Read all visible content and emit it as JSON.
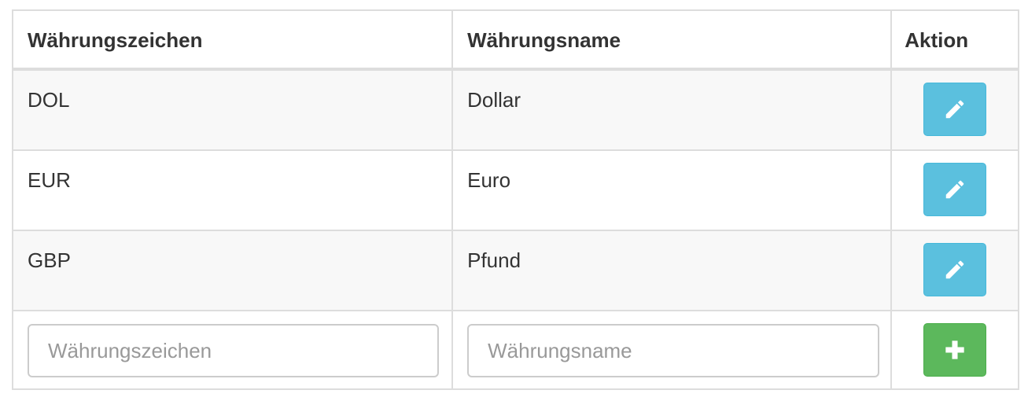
{
  "table": {
    "headers": {
      "code": "Währungszeichen",
      "name": "Währungsname",
      "action": "Aktion"
    },
    "rows": [
      {
        "code": "DOL",
        "name": "Dollar"
      },
      {
        "code": "EUR",
        "name": "Euro"
      },
      {
        "code": "GBP",
        "name": "Pfund"
      }
    ],
    "new_row": {
      "code_placeholder": "Währungszeichen",
      "name_placeholder": "Währungsname"
    }
  },
  "icons": {
    "edit": "pencil-icon",
    "add": "plus-icon"
  },
  "colors": {
    "edit_button": "#5bc0de",
    "add_button": "#5cb85c",
    "stripe": "#f8f8f8",
    "border": "#dddddd"
  }
}
